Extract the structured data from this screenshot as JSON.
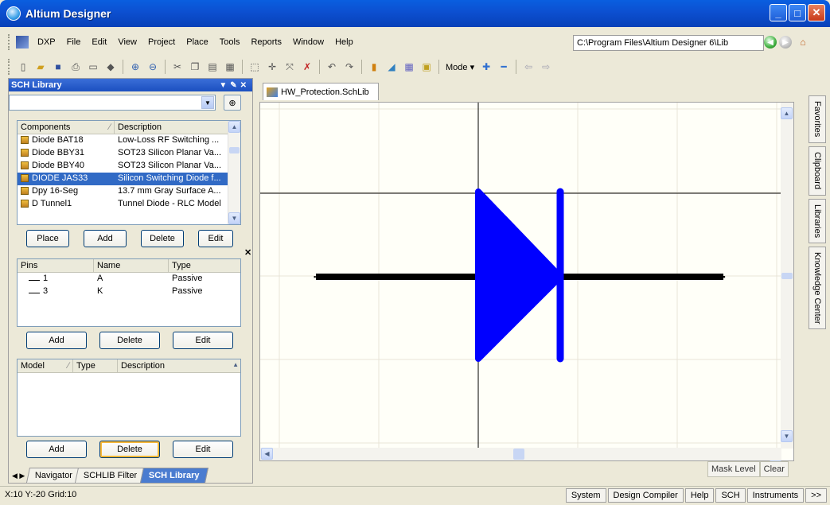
{
  "window": {
    "title": "Altium Designer"
  },
  "menu": [
    "DXP",
    "File",
    "Edit",
    "View",
    "Project",
    "Place",
    "Tools",
    "Reports",
    "Window",
    "Help"
  ],
  "path": "C:\\Program Files\\Altium Designer 6\\Lib",
  "toolbar": {
    "mode_label": "Mode"
  },
  "panel": {
    "title": "SCH Library",
    "filter_value": "",
    "components": {
      "headers": [
        "Components",
        "Description"
      ],
      "rows": [
        {
          "name": "Diode BAT18",
          "desc": "Low-Loss RF Switching ..."
        },
        {
          "name": "Diode BBY31",
          "desc": "SOT23 Silicon Planar Va..."
        },
        {
          "name": "Diode BBY40",
          "desc": "SOT23 Silicon Planar Va..."
        },
        {
          "name": "DIODE JAS33",
          "desc": "Silicon Switching Diode f..."
        },
        {
          "name": "Dpy 16-Seg",
          "desc": "13.7 mm Gray Surface A..."
        },
        {
          "name": "D Tunnel1",
          "desc": "Tunnel Diode - RLC Model"
        }
      ],
      "selected_index": 3
    },
    "comp_buttons": [
      "Place",
      "Add",
      "Delete",
      "Edit"
    ],
    "pins": {
      "headers": [
        "Pins",
        "Name",
        "Type"
      ],
      "rows": [
        {
          "pin": "1",
          "name": "A",
          "type": "Passive"
        },
        {
          "pin": "3",
          "name": "K",
          "type": "Passive"
        }
      ]
    },
    "pin_buttons": [
      "Add",
      "Delete",
      "Edit"
    ],
    "models": {
      "headers": [
        "Model",
        "Type",
        "Description"
      ]
    },
    "model_buttons": [
      "Add",
      "Delete",
      "Edit"
    ],
    "tabs": [
      "Navigator",
      "SCHLIB Filter",
      "SCH Library"
    ]
  },
  "document": {
    "tab": "HW_Protection.SchLib"
  },
  "schematic": {
    "body_color": "#0000ff",
    "lead_color": "#000000",
    "grid_color": "#e8e4d8",
    "axis_color": "#000000"
  },
  "right_tabs": [
    "Favorites",
    "Clipboard",
    "Libraries",
    "Knowledge Center"
  ],
  "mask": {
    "label": "Mask Level",
    "clear": "Clear"
  },
  "status": {
    "coords": "X:10 Y:-20   Grid:10",
    "buttons": [
      "System",
      "Design Compiler",
      "Help",
      "SCH",
      "Instruments",
      ">>"
    ]
  }
}
